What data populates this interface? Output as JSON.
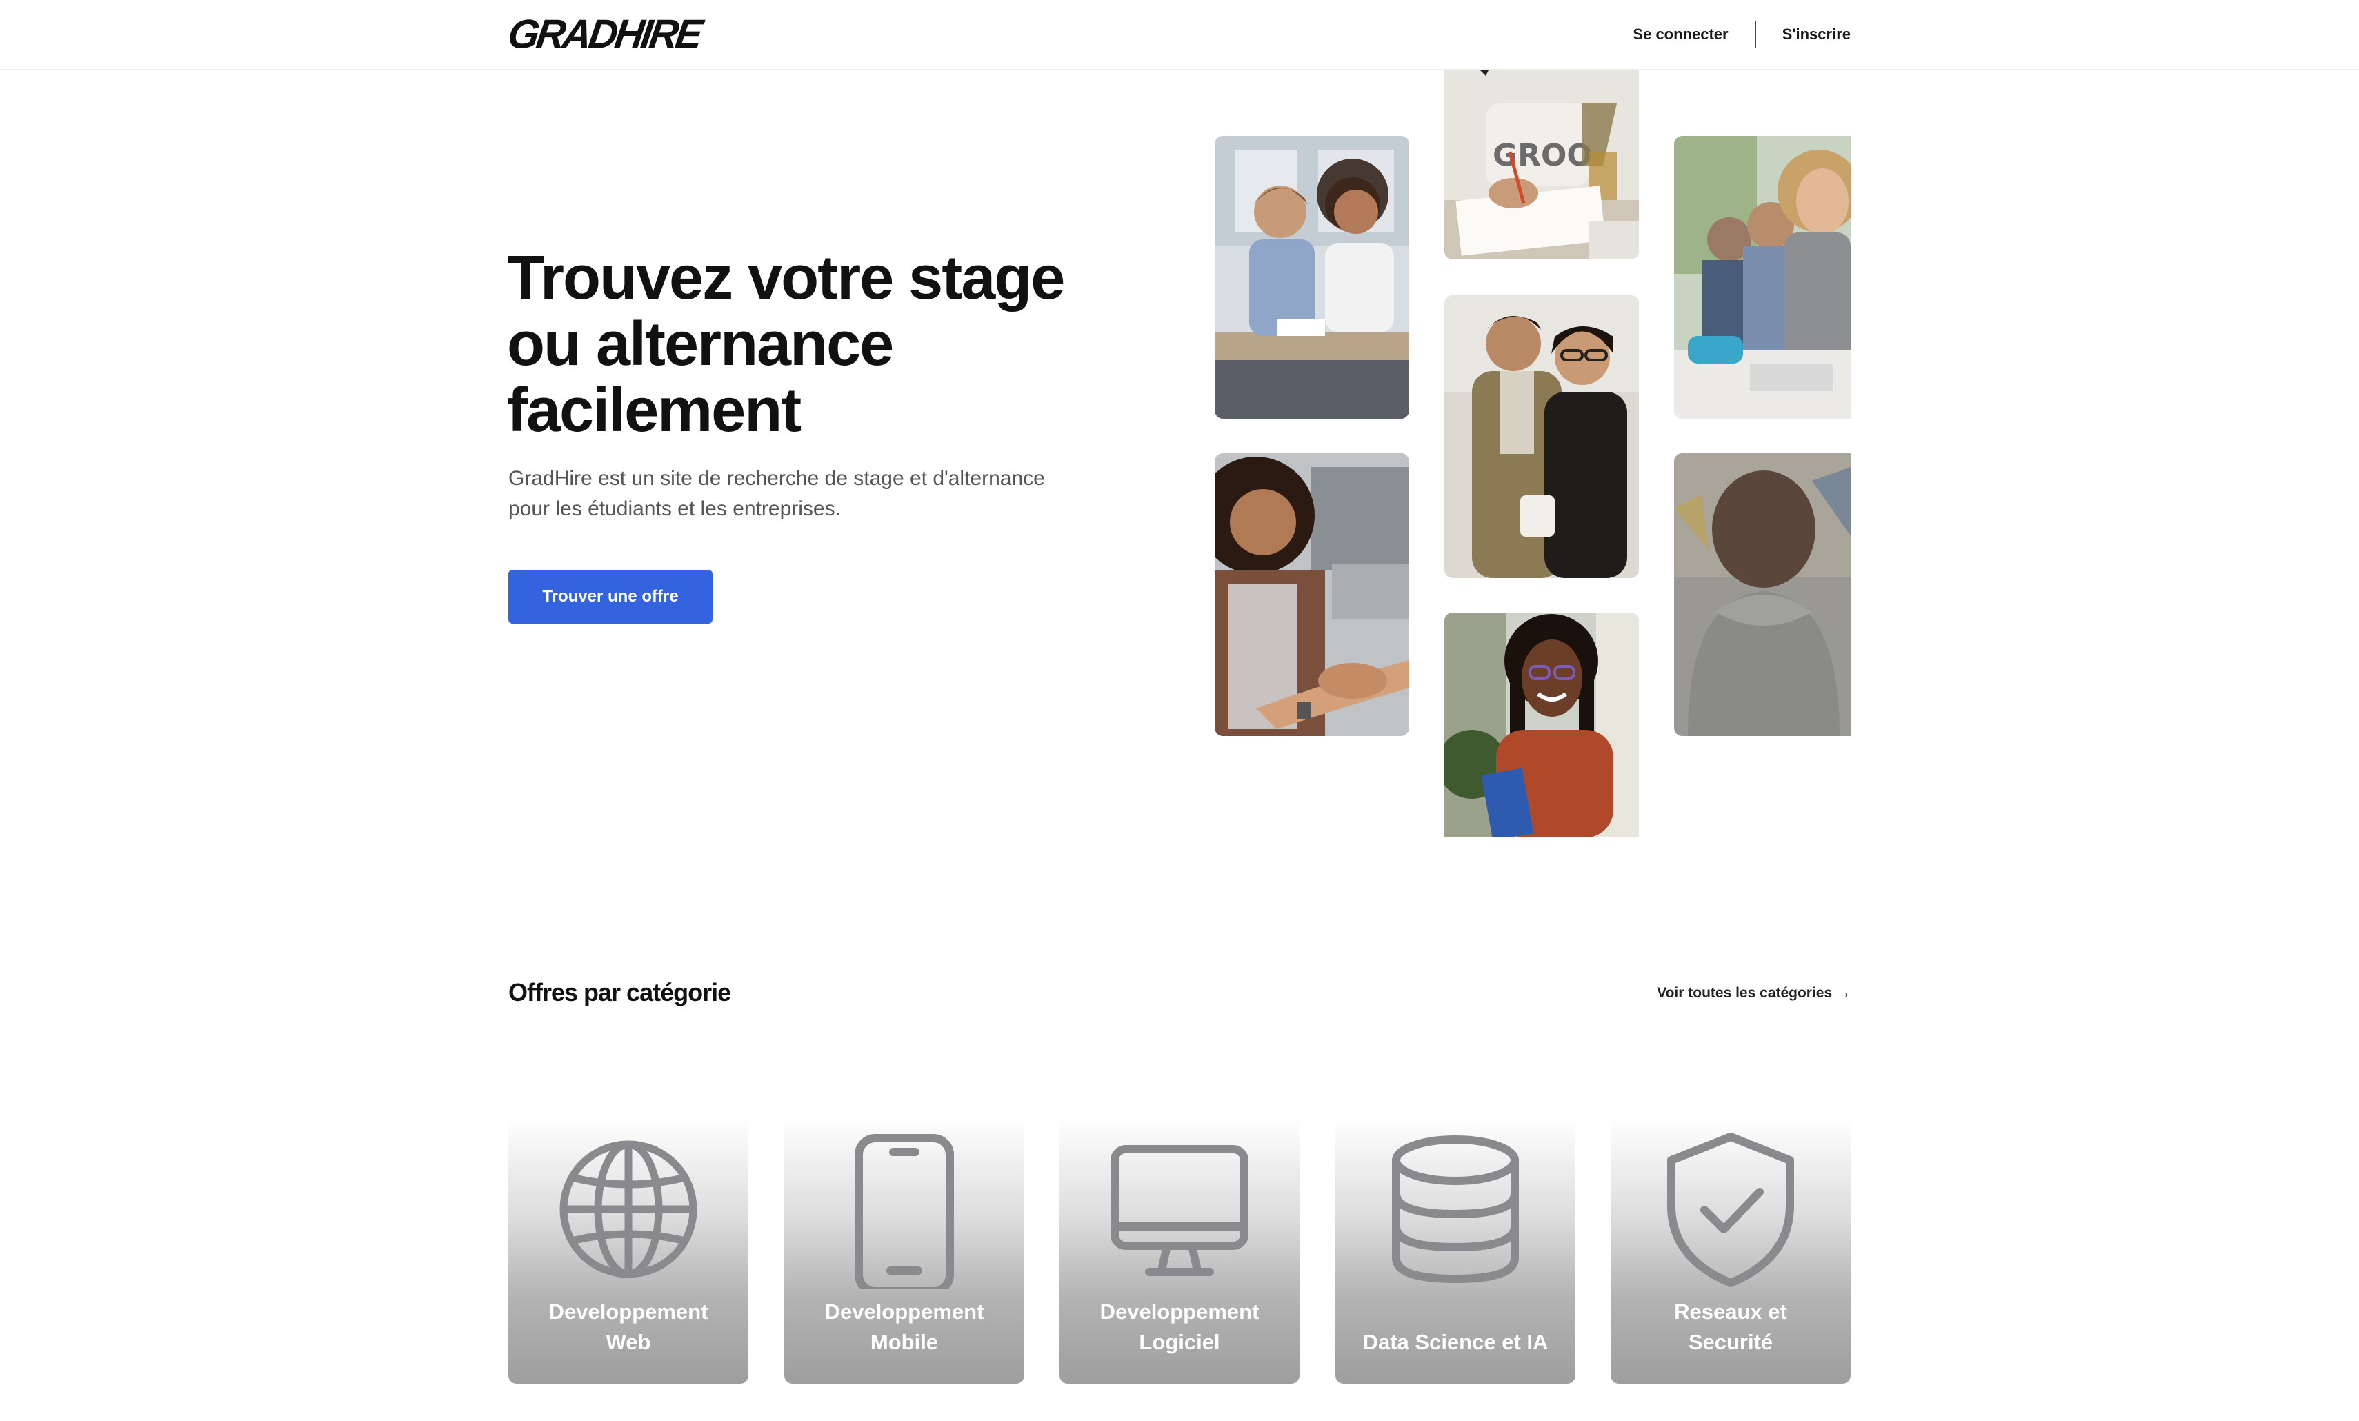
{
  "header": {
    "logo": "GRADHIRE",
    "login_label": "Se connecter",
    "signup_label": "S'inscrire"
  },
  "hero": {
    "title_line1": "Trouvez votre stage",
    "title_line2": "ou alternance",
    "title_line3": "facilement",
    "subtitle_line1": "GradHire est un site de recherche de stage et d'alternance",
    "subtitle_line2": "pour les étudiants et les entreprises.",
    "cta_label": "Trouver une offre"
  },
  "categories_section": {
    "title": "Offres par catégorie",
    "see_all_label": "Voir toutes les catégories →",
    "items": [
      {
        "line1": "Developpement",
        "line2": "Web",
        "icon": "globe-icon"
      },
      {
        "line1": "Developpement",
        "line2": "Mobile",
        "icon": "smartphone-icon"
      },
      {
        "line1": "Developpement",
        "line2": "Logiciel",
        "icon": "monitor-icon"
      },
      {
        "line1": "",
        "line2": "Data Science et IA",
        "icon": "database-icon"
      },
      {
        "line1": "Reseaux et",
        "line2": "Securité",
        "icon": "shield-check-icon"
      }
    ]
  },
  "colors": {
    "accent": "#3463e0",
    "text": "#111111",
    "muted": "#555555",
    "icon_gray": "#8a8a8e"
  }
}
